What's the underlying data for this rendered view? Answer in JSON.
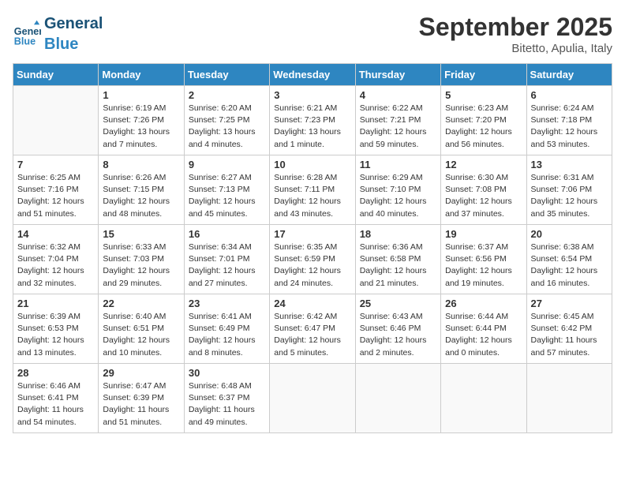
{
  "header": {
    "logo_general": "General",
    "logo_blue": "Blue",
    "month_title": "September 2025",
    "location": "Bitetto, Apulia, Italy"
  },
  "weekdays": [
    "Sunday",
    "Monday",
    "Tuesday",
    "Wednesday",
    "Thursday",
    "Friday",
    "Saturday"
  ],
  "weeks": [
    [
      {
        "day": "",
        "info": ""
      },
      {
        "day": "1",
        "info": "Sunrise: 6:19 AM\nSunset: 7:26 PM\nDaylight: 13 hours\nand 7 minutes."
      },
      {
        "day": "2",
        "info": "Sunrise: 6:20 AM\nSunset: 7:25 PM\nDaylight: 13 hours\nand 4 minutes."
      },
      {
        "day": "3",
        "info": "Sunrise: 6:21 AM\nSunset: 7:23 PM\nDaylight: 13 hours\nand 1 minute."
      },
      {
        "day": "4",
        "info": "Sunrise: 6:22 AM\nSunset: 7:21 PM\nDaylight: 12 hours\nand 59 minutes."
      },
      {
        "day": "5",
        "info": "Sunrise: 6:23 AM\nSunset: 7:20 PM\nDaylight: 12 hours\nand 56 minutes."
      },
      {
        "day": "6",
        "info": "Sunrise: 6:24 AM\nSunset: 7:18 PM\nDaylight: 12 hours\nand 53 minutes."
      }
    ],
    [
      {
        "day": "7",
        "info": "Sunrise: 6:25 AM\nSunset: 7:16 PM\nDaylight: 12 hours\nand 51 minutes."
      },
      {
        "day": "8",
        "info": "Sunrise: 6:26 AM\nSunset: 7:15 PM\nDaylight: 12 hours\nand 48 minutes."
      },
      {
        "day": "9",
        "info": "Sunrise: 6:27 AM\nSunset: 7:13 PM\nDaylight: 12 hours\nand 45 minutes."
      },
      {
        "day": "10",
        "info": "Sunrise: 6:28 AM\nSunset: 7:11 PM\nDaylight: 12 hours\nand 43 minutes."
      },
      {
        "day": "11",
        "info": "Sunrise: 6:29 AM\nSunset: 7:10 PM\nDaylight: 12 hours\nand 40 minutes."
      },
      {
        "day": "12",
        "info": "Sunrise: 6:30 AM\nSunset: 7:08 PM\nDaylight: 12 hours\nand 37 minutes."
      },
      {
        "day": "13",
        "info": "Sunrise: 6:31 AM\nSunset: 7:06 PM\nDaylight: 12 hours\nand 35 minutes."
      }
    ],
    [
      {
        "day": "14",
        "info": "Sunrise: 6:32 AM\nSunset: 7:04 PM\nDaylight: 12 hours\nand 32 minutes."
      },
      {
        "day": "15",
        "info": "Sunrise: 6:33 AM\nSunset: 7:03 PM\nDaylight: 12 hours\nand 29 minutes."
      },
      {
        "day": "16",
        "info": "Sunrise: 6:34 AM\nSunset: 7:01 PM\nDaylight: 12 hours\nand 27 minutes."
      },
      {
        "day": "17",
        "info": "Sunrise: 6:35 AM\nSunset: 6:59 PM\nDaylight: 12 hours\nand 24 minutes."
      },
      {
        "day": "18",
        "info": "Sunrise: 6:36 AM\nSunset: 6:58 PM\nDaylight: 12 hours\nand 21 minutes."
      },
      {
        "day": "19",
        "info": "Sunrise: 6:37 AM\nSunset: 6:56 PM\nDaylight: 12 hours\nand 19 minutes."
      },
      {
        "day": "20",
        "info": "Sunrise: 6:38 AM\nSunset: 6:54 PM\nDaylight: 12 hours\nand 16 minutes."
      }
    ],
    [
      {
        "day": "21",
        "info": "Sunrise: 6:39 AM\nSunset: 6:53 PM\nDaylight: 12 hours\nand 13 minutes."
      },
      {
        "day": "22",
        "info": "Sunrise: 6:40 AM\nSunset: 6:51 PM\nDaylight: 12 hours\nand 10 minutes."
      },
      {
        "day": "23",
        "info": "Sunrise: 6:41 AM\nSunset: 6:49 PM\nDaylight: 12 hours\nand 8 minutes."
      },
      {
        "day": "24",
        "info": "Sunrise: 6:42 AM\nSunset: 6:47 PM\nDaylight: 12 hours\nand 5 minutes."
      },
      {
        "day": "25",
        "info": "Sunrise: 6:43 AM\nSunset: 6:46 PM\nDaylight: 12 hours\nand 2 minutes."
      },
      {
        "day": "26",
        "info": "Sunrise: 6:44 AM\nSunset: 6:44 PM\nDaylight: 12 hours\nand 0 minutes."
      },
      {
        "day": "27",
        "info": "Sunrise: 6:45 AM\nSunset: 6:42 PM\nDaylight: 11 hours\nand 57 minutes."
      }
    ],
    [
      {
        "day": "28",
        "info": "Sunrise: 6:46 AM\nSunset: 6:41 PM\nDaylight: 11 hours\nand 54 minutes."
      },
      {
        "day": "29",
        "info": "Sunrise: 6:47 AM\nSunset: 6:39 PM\nDaylight: 11 hours\nand 51 minutes."
      },
      {
        "day": "30",
        "info": "Sunrise: 6:48 AM\nSunset: 6:37 PM\nDaylight: 11 hours\nand 49 minutes."
      },
      {
        "day": "",
        "info": ""
      },
      {
        "day": "",
        "info": ""
      },
      {
        "day": "",
        "info": ""
      },
      {
        "day": "",
        "info": ""
      }
    ]
  ]
}
